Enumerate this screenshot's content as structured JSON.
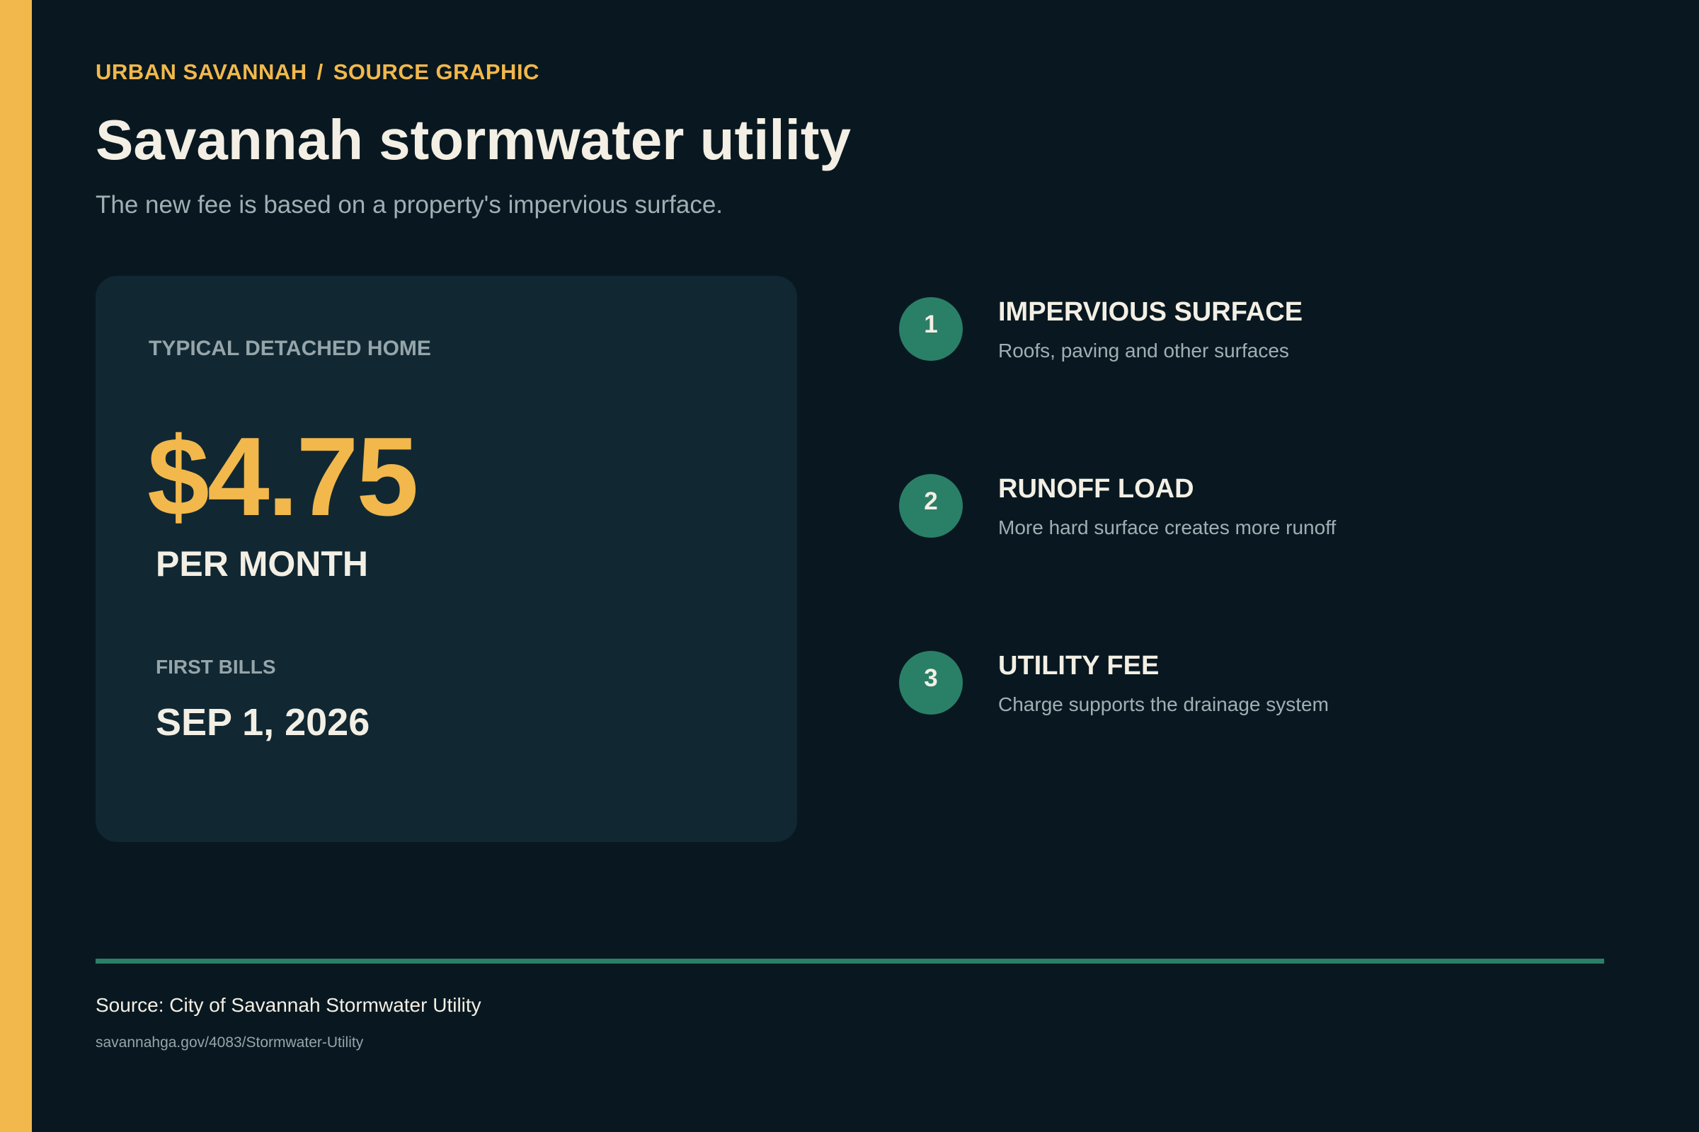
{
  "header": {
    "kicker_left": "URBAN SAVANNAH",
    "kicker_separator": "/",
    "kicker_right": "SOURCE GRAPHIC",
    "title": "Savannah stormwater utility",
    "subtitle": "The new fee is based on a property's impervious surface."
  },
  "card": {
    "label": "TYPICAL DETACHED HOME",
    "price": "$4.75",
    "unit": "PER MONTH",
    "first_bills_label": "FIRST BILLS",
    "first_bills_date": "SEP 1, 2026"
  },
  "steps": [
    {
      "number": "1",
      "title": "IMPERVIOUS SURFACE",
      "description": "Roofs, paving and other surfaces"
    },
    {
      "number": "2",
      "title": "RUNOFF LOAD",
      "description": "More hard surface creates more runoff"
    },
    {
      "number": "3",
      "title": "UTILITY FEE",
      "description": "Charge supports the drainage system"
    }
  ],
  "footer": {
    "source": "Source: City of Savannah Stormwater Utility",
    "url": "savannahga.gov/4083/Stormwater-Utility"
  },
  "colors": {
    "background": "#091820",
    "accent": "#f2b84b",
    "card": "#112833",
    "step_circle": "#2a7f67",
    "text_light": "#f3efe4",
    "text_muted": "#9fb0b5"
  }
}
